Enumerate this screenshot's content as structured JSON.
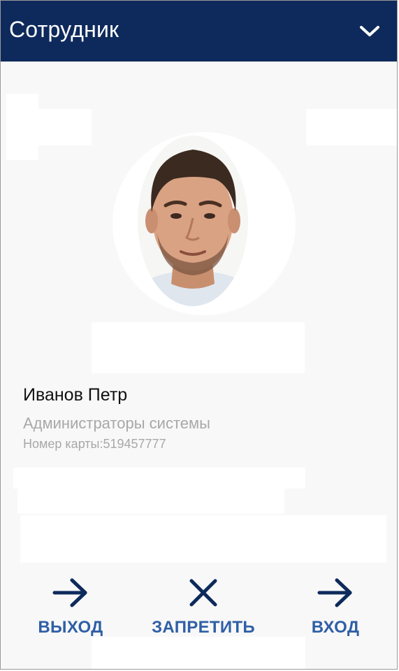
{
  "header": {
    "title": "Сотрудник",
    "menu_icon": "chevron-down-icon",
    "background": "#0e2a5c"
  },
  "employee": {
    "name": "Иванов Петр",
    "group": "Администраторы системы",
    "card_number": "Номер карты:519457777"
  },
  "actions": [
    {
      "label": "ВЫХОД",
      "icon": "arrow-right-icon"
    },
    {
      "label": "ЗАПРЕТИТЬ",
      "icon": "close-icon"
    },
    {
      "label": "ВХОД",
      "icon": "arrow-right-icon"
    }
  ],
  "colors": {
    "accent": "#2f5fa6",
    "icon": "#0e2a5c",
    "secondary_text": "#a8a8a8"
  }
}
